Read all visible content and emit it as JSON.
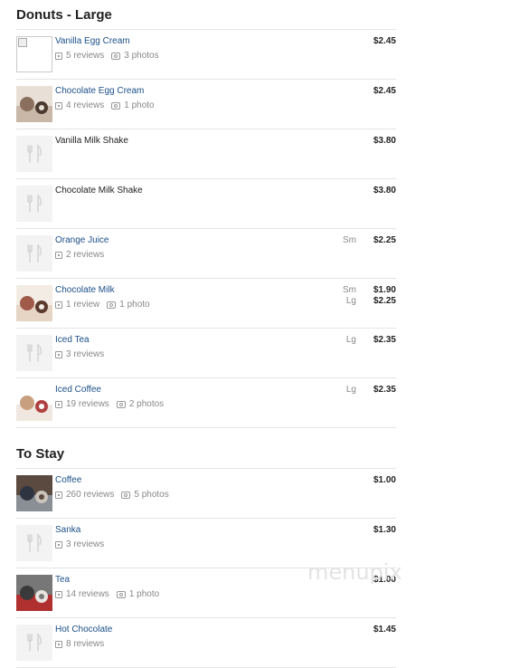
{
  "sections": [
    {
      "title": "Donuts - Large",
      "items": [
        {
          "name": "Vanilla Egg Cream",
          "reviews": "5 reviews",
          "photos": "3 photos",
          "sizes": [],
          "prices": [
            "$2.45"
          ],
          "thumb": "broken-image-icon",
          "linked": true
        },
        {
          "name": "Chocolate Egg Cream",
          "reviews": "4 reviews",
          "photos": "1 photo",
          "sizes": [],
          "prices": [
            "$2.45"
          ],
          "thumb": "photo-icon",
          "linked": true
        },
        {
          "name": "Vanilla Milk Shake",
          "reviews": "",
          "photos": "",
          "sizes": [],
          "prices": [
            "$3.80"
          ],
          "thumb": "utensils-icon",
          "linked": false
        },
        {
          "name": "Chocolate Milk Shake",
          "reviews": "",
          "photos": "",
          "sizes": [],
          "prices": [
            "$3.80"
          ],
          "thumb": "utensils-icon",
          "linked": false
        },
        {
          "name": "Orange Juice",
          "reviews": "2 reviews",
          "photos": "",
          "sizes": [
            "Sm"
          ],
          "prices": [
            "$2.25"
          ],
          "thumb": "utensils-icon",
          "linked": true
        },
        {
          "name": "Chocolate Milk",
          "reviews": "1 review",
          "photos": "1 photo",
          "sizes": [
            "Sm",
            "Lg"
          ],
          "prices": [
            "$1.90",
            "$2.25"
          ],
          "thumb": "photo-icon",
          "linked": true
        },
        {
          "name": "Iced Tea",
          "reviews": "3 reviews",
          "photos": "",
          "sizes": [
            "Lg"
          ],
          "prices": [
            "$2.35"
          ],
          "thumb": "utensils-icon",
          "linked": true
        },
        {
          "name": "Iced Coffee",
          "reviews": "19 reviews",
          "photos": "2 photos",
          "sizes": [
            "Lg"
          ],
          "prices": [
            "$2.35"
          ],
          "thumb": "photo-icon",
          "linked": true
        }
      ]
    },
    {
      "title": "To Stay",
      "items": [
        {
          "name": "Coffee",
          "reviews": "260 reviews",
          "photos": "5 photos",
          "sizes": [],
          "prices": [
            "$1.00"
          ],
          "thumb": "photo-icon",
          "linked": true
        },
        {
          "name": "Sanka",
          "reviews": "3 reviews",
          "photos": "",
          "sizes": [],
          "prices": [
            "$1.30"
          ],
          "thumb": "utensils-icon",
          "linked": true
        },
        {
          "name": "Tea",
          "reviews": "14 reviews",
          "photos": "1 photo",
          "sizes": [],
          "prices": [
            "$1.00"
          ],
          "thumb": "photo-icon",
          "linked": true
        },
        {
          "name": "Hot Chocolate",
          "reviews": "8 reviews",
          "photos": "",
          "sizes": [],
          "prices": [
            "$1.45"
          ],
          "thumb": "utensils-icon",
          "linked": true
        }
      ]
    }
  ],
  "watermark": "menupix",
  "colors": {
    "link": "#1c4f88",
    "muted": "#888888",
    "divider": "#e4e4e4"
  }
}
